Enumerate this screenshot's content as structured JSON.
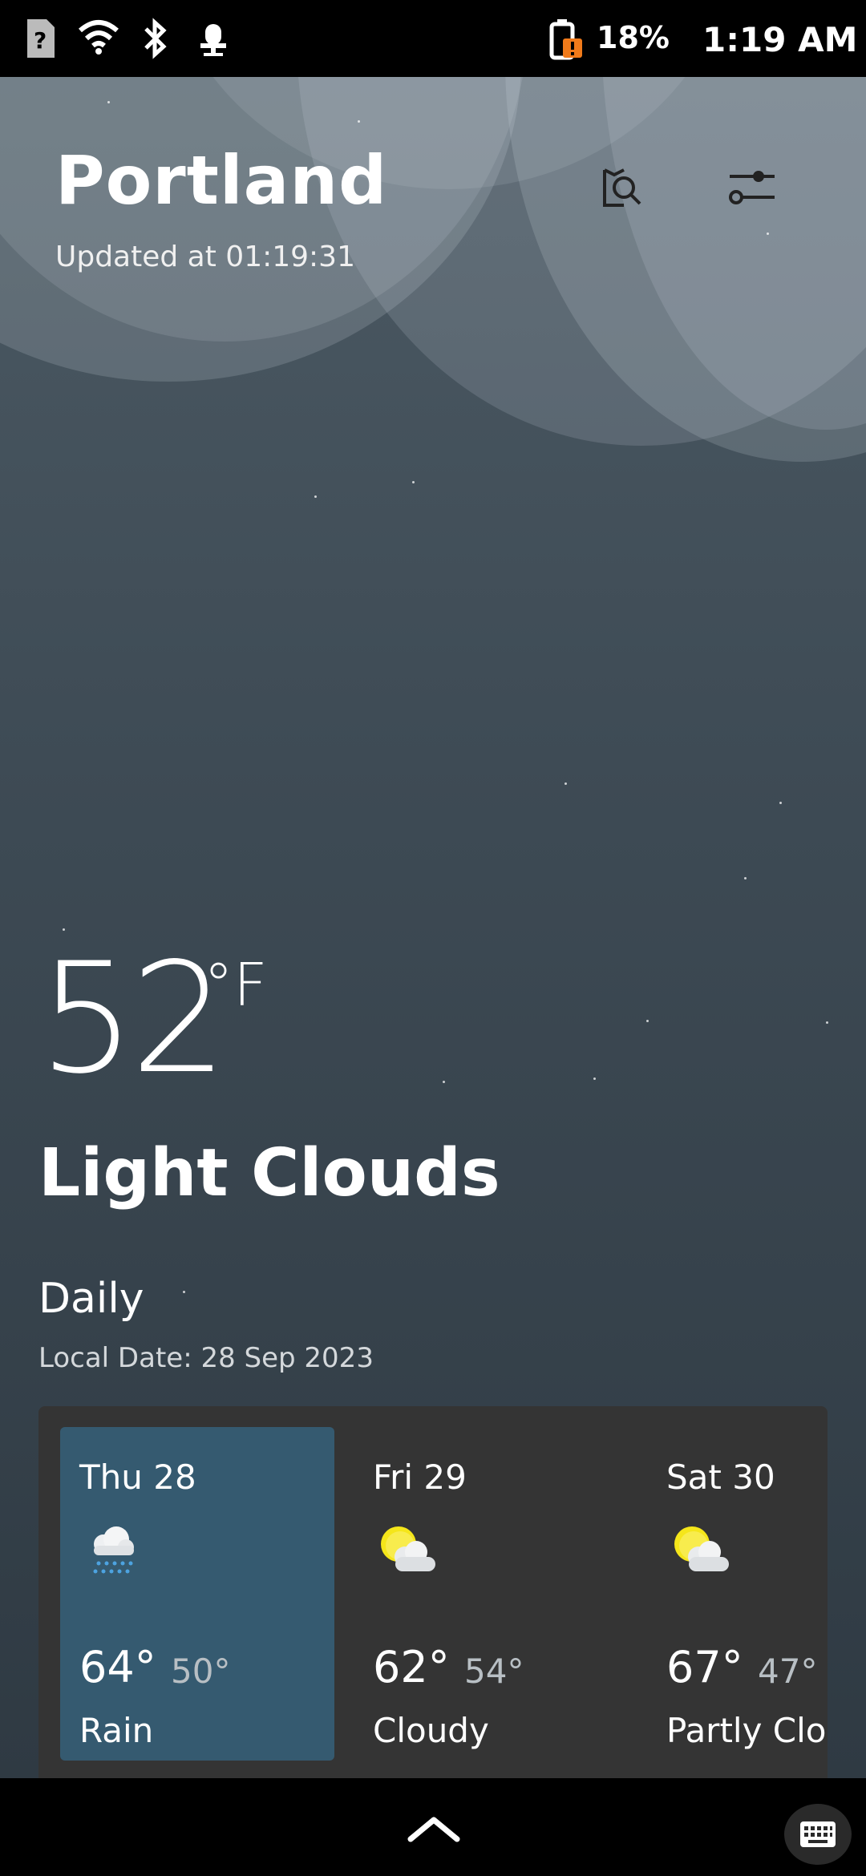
{
  "status_bar": {
    "battery_percent": "18%",
    "time": "1:19 AM"
  },
  "header": {
    "city": "Portland",
    "updated": "Updated at 01:19:31"
  },
  "current": {
    "temperature": "52",
    "unit": "°F",
    "condition": "Light Clouds"
  },
  "daily": {
    "title": "Daily",
    "local_date": "Local Date: 28 Sep 2023",
    "days": [
      {
        "name": "Thu 28",
        "high": "64°",
        "low": "50°",
        "condition": "Rain",
        "icon": "rain-icon"
      },
      {
        "name": "Fri 29",
        "high": "62°",
        "low": "54°",
        "condition": "Cloudy",
        "icon": "partly-cloudy-icon"
      },
      {
        "name": "Sat 30",
        "high": "67°",
        "low": "47°",
        "condition": "Partly Cloudy",
        "icon": "partly-cloudy-icon"
      }
    ]
  },
  "colors": {
    "accent_selected_card": "#355a70",
    "panel": "#343434",
    "battery_warning": "#f07a1a",
    "sun": "#f5e61a"
  }
}
